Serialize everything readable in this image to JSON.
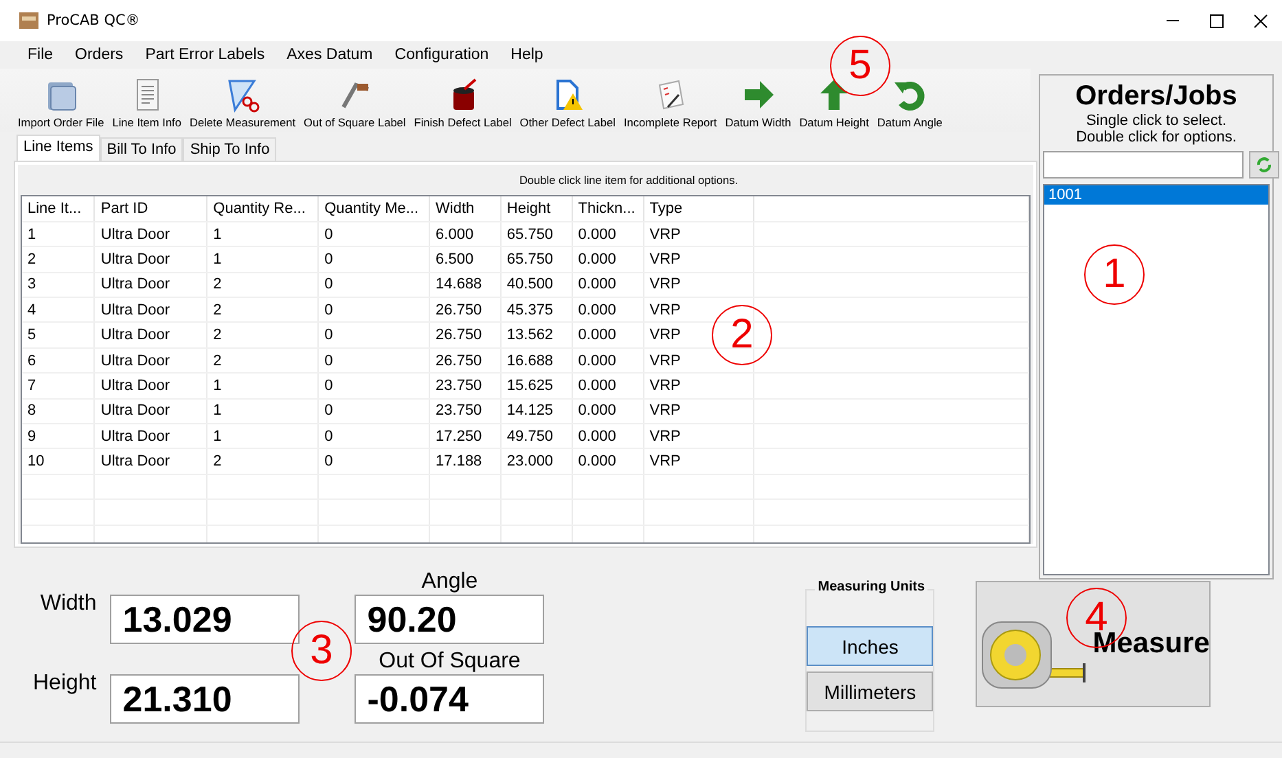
{
  "window": {
    "title": "ProCAB QC®"
  },
  "menu": [
    "File",
    "Orders",
    "Part Error Labels",
    "Axes Datum",
    "Configuration",
    "Help"
  ],
  "toolbar": [
    {
      "label": "Import Order File",
      "kind": "folder"
    },
    {
      "label": "Line Item Info",
      "kind": "document"
    },
    {
      "label": "Delete Measurement",
      "kind": "delete"
    },
    {
      "label": "Out of Square Label",
      "kind": "square"
    },
    {
      "label": "Finish Defect Label",
      "kind": "paint"
    },
    {
      "label": "Other Defect Label",
      "kind": "warning"
    },
    {
      "label": "Incomplete Report",
      "kind": "report"
    },
    {
      "label": "Datum Width",
      "kind": "right"
    },
    {
      "label": "Datum Height",
      "kind": "up"
    },
    {
      "label": "Datum Angle",
      "kind": "rotate"
    }
  ],
  "tabs": [
    {
      "label": "Line Items",
      "selected": true
    },
    {
      "label": "Bill To Info",
      "selected": false
    },
    {
      "label": "Ship To Info",
      "selected": false
    }
  ],
  "hint": "Double click line item for additional options.",
  "table": {
    "columns": [
      "Line It...",
      "Part ID",
      "Quantity Re...",
      "Quantity Me...",
      "Width",
      "Height",
      "Thickn...",
      "Type"
    ],
    "rows": [
      [
        "1",
        "Ultra Door",
        "1",
        "0",
        "6.000",
        "65.750",
        "0.000",
        "VRP"
      ],
      [
        "2",
        "Ultra Door",
        "1",
        "0",
        "6.500",
        "65.750",
        "0.000",
        "VRP"
      ],
      [
        "3",
        "Ultra Door",
        "2",
        "0",
        "14.688",
        "40.500",
        "0.000",
        "VRP"
      ],
      [
        "4",
        "Ultra Door",
        "2",
        "0",
        "26.750",
        "45.375",
        "0.000",
        "VRP"
      ],
      [
        "5",
        "Ultra Door",
        "2",
        "0",
        "26.750",
        "13.562",
        "0.000",
        "VRP"
      ],
      [
        "6",
        "Ultra Door",
        "2",
        "0",
        "26.750",
        "16.688",
        "0.000",
        "VRP"
      ],
      [
        "7",
        "Ultra Door",
        "1",
        "0",
        "23.750",
        "15.625",
        "0.000",
        "VRP"
      ],
      [
        "8",
        "Ultra Door",
        "1",
        "0",
        "23.750",
        "14.125",
        "0.000",
        "VRP"
      ],
      [
        "9",
        "Ultra Door",
        "1",
        "0",
        "17.250",
        "49.750",
        "0.000",
        "VRP"
      ],
      [
        "10",
        "Ultra Door",
        "2",
        "0",
        "17.188",
        "23.000",
        "0.000",
        "VRP"
      ]
    ]
  },
  "readings": {
    "width": {
      "label": "Width",
      "value": "13.029"
    },
    "height": {
      "label": "Height",
      "value": "21.310"
    },
    "angle": {
      "label": "Angle",
      "value": "90.20"
    },
    "out_of_square": {
      "label": "Out Of Square",
      "value": "-0.074"
    }
  },
  "measuring_units": {
    "title": "Measuring Units",
    "options": [
      {
        "label": "Inches",
        "selected": true
      },
      {
        "label": "Millimeters",
        "selected": false
      }
    ]
  },
  "measure_button": {
    "label": "Measure"
  },
  "orders_panel": {
    "title": "Orders/Jobs",
    "instructions": [
      "Single click to select.",
      "Double click for options."
    ],
    "items": [
      {
        "label": "1001",
        "selected": true
      }
    ]
  },
  "callouts": [
    "1",
    "2",
    "3",
    "4",
    "5"
  ]
}
